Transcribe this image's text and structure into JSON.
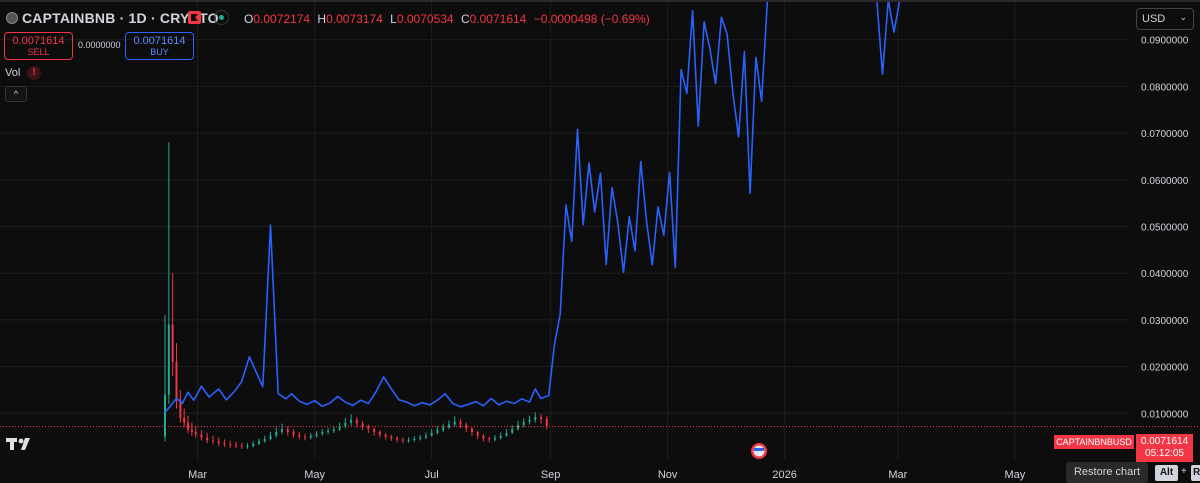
{
  "header": {
    "symbol": "CAPTAINBNB · 1D · CRYPTO",
    "ohlc": {
      "o_key": "O",
      "o_val": "0.0072174",
      "h_key": "H",
      "h_val": "0.0073174",
      "l_key": "L",
      "l_val": "0.0070534",
      "c_key": "C",
      "c_val": "0.0071614",
      "change": "−0.0000498 (−0.69%)"
    },
    "status_color": "#22ab94"
  },
  "trade": {
    "sell_price": "0.0071614",
    "sell_label": "SELL",
    "spread": "0.0000000",
    "buy_price": "0.0071614",
    "buy_label": "BUY"
  },
  "indicators": {
    "vol_label": "Vol",
    "vol_warning": "!",
    "collapse": "^"
  },
  "currency": {
    "value": "USD",
    "chevron": "⌄"
  },
  "price_line": {
    "symbol_tag": "CAPTAINBNBUSD",
    "last_price": "0.0071614",
    "countdown": "05:12:05"
  },
  "footer": {
    "restore_label": "Restore chart",
    "key_alt": "Alt",
    "key_plus": "+",
    "key_r": "R"
  },
  "chart_data": {
    "type": "line",
    "colors": {
      "series": "#2962ff",
      "up": "#22ab94",
      "down": "#f23645",
      "last_price": "#f23645",
      "grid": "#1e1e1e"
    },
    "y_ticks": [
      "0.0100000",
      "0.0200000",
      "0.0300000",
      "0.0400000",
      "0.0500000",
      "0.0600000",
      "0.0700000",
      "0.0800000",
      "0.0900000"
    ],
    "y_tick_values": [
      0.01,
      0.02,
      0.03,
      0.04,
      0.05,
      0.06,
      0.07,
      0.08,
      0.09
    ],
    "ylim": [
      0.0,
      0.0985
    ],
    "x_ticks": [
      "Mar",
      "May",
      "Jul",
      "Sep",
      "Nov",
      "2026",
      "Mar",
      "May"
    ],
    "x_tick_dates": [
      "2025-03-01",
      "2025-05-01",
      "2025-07-01",
      "2025-09-01",
      "2025-11-01",
      "2026-01-01",
      "2026-03-01",
      "2026-05-01"
    ],
    "xlim": [
      "2024-11-18",
      "2026-06-30"
    ],
    "last_value": 0.0071614,
    "blue_series": {
      "dates": [
        "2025-02-12",
        "2025-02-15",
        "2025-02-18",
        "2025-02-21",
        "2025-02-24",
        "2025-02-27",
        "2025-03-03",
        "2025-03-07",
        "2025-03-12",
        "2025-03-16",
        "2025-03-20",
        "2025-03-24",
        "2025-03-28",
        "2025-04-01",
        "2025-04-04",
        "2025-04-08",
        "2025-04-12",
        "2025-04-16",
        "2025-04-19",
        "2025-04-23",
        "2025-04-27",
        "2025-05-01",
        "2025-05-05",
        "2025-05-09",
        "2025-05-13",
        "2025-05-17",
        "2025-05-21",
        "2025-05-25",
        "2025-05-29",
        "2025-06-02",
        "2025-06-06",
        "2025-06-10",
        "2025-06-14",
        "2025-06-18",
        "2025-06-22",
        "2025-06-26",
        "2025-06-30",
        "2025-07-04",
        "2025-07-08",
        "2025-07-12",
        "2025-07-16",
        "2025-07-20",
        "2025-07-24",
        "2025-07-28",
        "2025-08-01",
        "2025-08-05",
        "2025-08-09",
        "2025-08-13",
        "2025-08-17",
        "2025-08-21",
        "2025-08-24",
        "2025-08-27",
        "2025-08-31",
        "2025-09-03",
        "2025-09-06",
        "2025-09-09",
        "2025-09-12",
        "2025-09-15",
        "2025-09-18",
        "2025-09-21",
        "2025-09-24",
        "2025-09-27",
        "2025-09-30",
        "2025-10-03",
        "2025-10-06",
        "2025-10-09",
        "2025-10-12",
        "2025-10-15",
        "2025-10-18",
        "2025-10-21",
        "2025-10-24",
        "2025-10-27",
        "2025-10-30",
        "2025-11-02",
        "2025-11-05",
        "2025-11-08",
        "2025-11-11",
        "2025-11-14",
        "2025-11-17",
        "2025-11-20",
        "2025-11-23",
        "2025-11-26",
        "2025-11-29",
        "2025-12-02",
        "2025-12-05",
        "2025-12-08",
        "2025-12-11",
        "2025-12-14",
        "2025-12-17",
        "2025-12-20",
        "2025-12-23",
        "2025-12-26",
        "2025-12-29",
        "2026-01-01",
        "2026-01-05",
        "2026-01-10",
        "2026-01-15",
        "2026-01-20",
        "2026-01-25",
        "2026-01-30",
        "2026-02-03",
        "2026-02-07",
        "2026-02-11",
        "2026-02-15",
        "2026-02-18",
        "2026-02-21",
        "2026-02-24",
        "2026-02-27",
        "2026-03-02"
      ],
      "values": [
        0.0102,
        0.0116,
        0.0132,
        0.0121,
        0.0145,
        0.0128,
        0.0158,
        0.0135,
        0.0152,
        0.0129,
        0.0146,
        0.0168,
        0.0221,
        0.0184,
        0.0157,
        0.0503,
        0.0142,
        0.0131,
        0.0142,
        0.0126,
        0.0119,
        0.0127,
        0.0115,
        0.0122,
        0.0136,
        0.0124,
        0.0117,
        0.0128,
        0.0121,
        0.0146,
        0.0178,
        0.0152,
        0.0129,
        0.0124,
        0.0116,
        0.0123,
        0.0118,
        0.0128,
        0.0142,
        0.0121,
        0.0114,
        0.0119,
        0.0125,
        0.0116,
        0.0132,
        0.0118,
        0.0126,
        0.0121,
        0.0131,
        0.0124,
        0.0152,
        0.0132,
        0.0138,
        0.0247,
        0.0312,
        0.0546,
        0.0468,
        0.0708,
        0.0504,
        0.0636,
        0.0531,
        0.0614,
        0.0419,
        0.0583,
        0.0508,
        0.0402,
        0.0521,
        0.0448,
        0.0639,
        0.0512,
        0.0418,
        0.0542,
        0.0481,
        0.0616,
        0.0412,
        0.0836,
        0.0785,
        0.0962,
        0.0715,
        0.0938,
        0.0882,
        0.0806,
        0.0948,
        0.0912,
        0.0785,
        0.0692,
        0.0875,
        0.0571,
        0.0862,
        0.0768,
        0.0985,
        0.0985,
        0.0985,
        0.0985,
        0.0985,
        0.0985,
        0.0985,
        0.0985,
        0.0985,
        0.0985,
        0.0985,
        0.0985,
        0.0985,
        0.0985,
        0.0985,
        0.0826,
        0.0985,
        0.0916,
        0.0985
      ]
    },
    "candles": {
      "dates": [
        "2025-02-12",
        "2025-02-14",
        "2025-02-16",
        "2025-02-18",
        "2025-02-20",
        "2025-02-22",
        "2025-02-24",
        "2025-02-26",
        "2025-02-28",
        "2025-03-03",
        "2025-03-06",
        "2025-03-09",
        "2025-03-12",
        "2025-03-15",
        "2025-03-18",
        "2025-03-21",
        "2025-03-24",
        "2025-03-27",
        "2025-03-30",
        "2025-04-02",
        "2025-04-05",
        "2025-04-08",
        "2025-04-11",
        "2025-04-14",
        "2025-04-17",
        "2025-04-20",
        "2025-04-23",
        "2025-04-26",
        "2025-04-29",
        "2025-05-02",
        "2025-05-05",
        "2025-05-08",
        "2025-05-11",
        "2025-05-14",
        "2025-05-17",
        "2025-05-20",
        "2025-05-23",
        "2025-05-26",
        "2025-05-29",
        "2025-06-01",
        "2025-06-04",
        "2025-06-07",
        "2025-06-10",
        "2025-06-13",
        "2025-06-16",
        "2025-06-19",
        "2025-06-22",
        "2025-06-25",
        "2025-06-28",
        "2025-07-01",
        "2025-07-04",
        "2025-07-07",
        "2025-07-10",
        "2025-07-13",
        "2025-07-16",
        "2025-07-19",
        "2025-07-22",
        "2025-07-25",
        "2025-07-28",
        "2025-07-31",
        "2025-08-03",
        "2025-08-06",
        "2025-08-09",
        "2025-08-12",
        "2025-08-15",
        "2025-08-18",
        "2025-08-21",
        "2025-08-24",
        "2025-08-27",
        "2025-08-30"
      ],
      "open": [
        0.005,
        0.014,
        0.029,
        0.021,
        0.013,
        0.009,
        0.008,
        0.0065,
        0.006,
        0.0055,
        0.0048,
        0.0042,
        0.004,
        0.0036,
        0.0034,
        0.0032,
        0.0031,
        0.003,
        0.003,
        0.0035,
        0.004,
        0.0045,
        0.0052,
        0.006,
        0.0066,
        0.006,
        0.0054,
        0.005,
        0.0048,
        0.0052,
        0.0056,
        0.006,
        0.0062,
        0.0065,
        0.0072,
        0.008,
        0.0086,
        0.0078,
        0.0072,
        0.0066,
        0.006,
        0.0054,
        0.005,
        0.0047,
        0.0044,
        0.0042,
        0.0043,
        0.0045,
        0.0048,
        0.0052,
        0.0058,
        0.0064,
        0.007,
        0.0076,
        0.0082,
        0.0076,
        0.0068,
        0.006,
        0.0052,
        0.0046,
        0.0044,
        0.0047,
        0.0052,
        0.0058,
        0.0066,
        0.0075,
        0.0082,
        0.0086,
        0.0092,
        0.0088
      ],
      "close": [
        0.014,
        0.029,
        0.021,
        0.013,
        0.009,
        0.008,
        0.0065,
        0.006,
        0.0055,
        0.0048,
        0.0042,
        0.004,
        0.0036,
        0.0034,
        0.0032,
        0.0031,
        0.003,
        0.003,
        0.0035,
        0.004,
        0.0045,
        0.0052,
        0.006,
        0.0066,
        0.006,
        0.0054,
        0.005,
        0.0048,
        0.0052,
        0.0056,
        0.006,
        0.0062,
        0.0065,
        0.0072,
        0.008,
        0.0086,
        0.0078,
        0.0072,
        0.0066,
        0.006,
        0.0054,
        0.005,
        0.0047,
        0.0044,
        0.0042,
        0.0043,
        0.0045,
        0.0048,
        0.0052,
        0.0058,
        0.0064,
        0.007,
        0.0076,
        0.0082,
        0.0076,
        0.0068,
        0.006,
        0.0052,
        0.0046,
        0.0044,
        0.0047,
        0.0052,
        0.0058,
        0.0066,
        0.0075,
        0.0082,
        0.0086,
        0.0092,
        0.0088,
        0.0072
      ],
      "high": [
        0.031,
        0.068,
        0.04,
        0.025,
        0.015,
        0.011,
        0.0095,
        0.008,
        0.0072,
        0.0065,
        0.0058,
        0.0052,
        0.0048,
        0.0044,
        0.0041,
        0.0039,
        0.0037,
        0.0036,
        0.004,
        0.0046,
        0.0052,
        0.006,
        0.007,
        0.0078,
        0.0072,
        0.0066,
        0.006,
        0.0056,
        0.0058,
        0.0062,
        0.0066,
        0.0069,
        0.0072,
        0.008,
        0.009,
        0.0098,
        0.0092,
        0.0084,
        0.0076,
        0.007,
        0.0064,
        0.0058,
        0.0054,
        0.0051,
        0.0048,
        0.0049,
        0.0051,
        0.0054,
        0.0059,
        0.0066,
        0.0072,
        0.0078,
        0.0085,
        0.0094,
        0.0088,
        0.008,
        0.007,
        0.0062,
        0.0055,
        0.005,
        0.0053,
        0.0059,
        0.0066,
        0.0074,
        0.0084,
        0.009,
        0.0095,
        0.0102,
        0.0098,
        0.0094
      ],
      "low": [
        0.004,
        0.012,
        0.018,
        0.011,
        0.008,
        0.007,
        0.0058,
        0.0052,
        0.0048,
        0.0042,
        0.0036,
        0.0034,
        0.003,
        0.0028,
        0.0026,
        0.0025,
        0.0024,
        0.0024,
        0.0027,
        0.0032,
        0.0037,
        0.0042,
        0.0048,
        0.0055,
        0.0052,
        0.0048,
        0.0044,
        0.0042,
        0.0044,
        0.0048,
        0.0052,
        0.0055,
        0.0058,
        0.0062,
        0.0068,
        0.0074,
        0.007,
        0.0064,
        0.0058,
        0.0052,
        0.0048,
        0.0044,
        0.0041,
        0.0038,
        0.0036,
        0.0037,
        0.0039,
        0.0042,
        0.0045,
        0.005,
        0.0055,
        0.006,
        0.0066,
        0.0072,
        0.0068,
        0.006,
        0.0052,
        0.0045,
        0.004,
        0.0038,
        0.004,
        0.0044,
        0.005,
        0.0056,
        0.0063,
        0.007,
        0.0076,
        0.008,
        0.0078,
        0.0066
      ]
    }
  }
}
